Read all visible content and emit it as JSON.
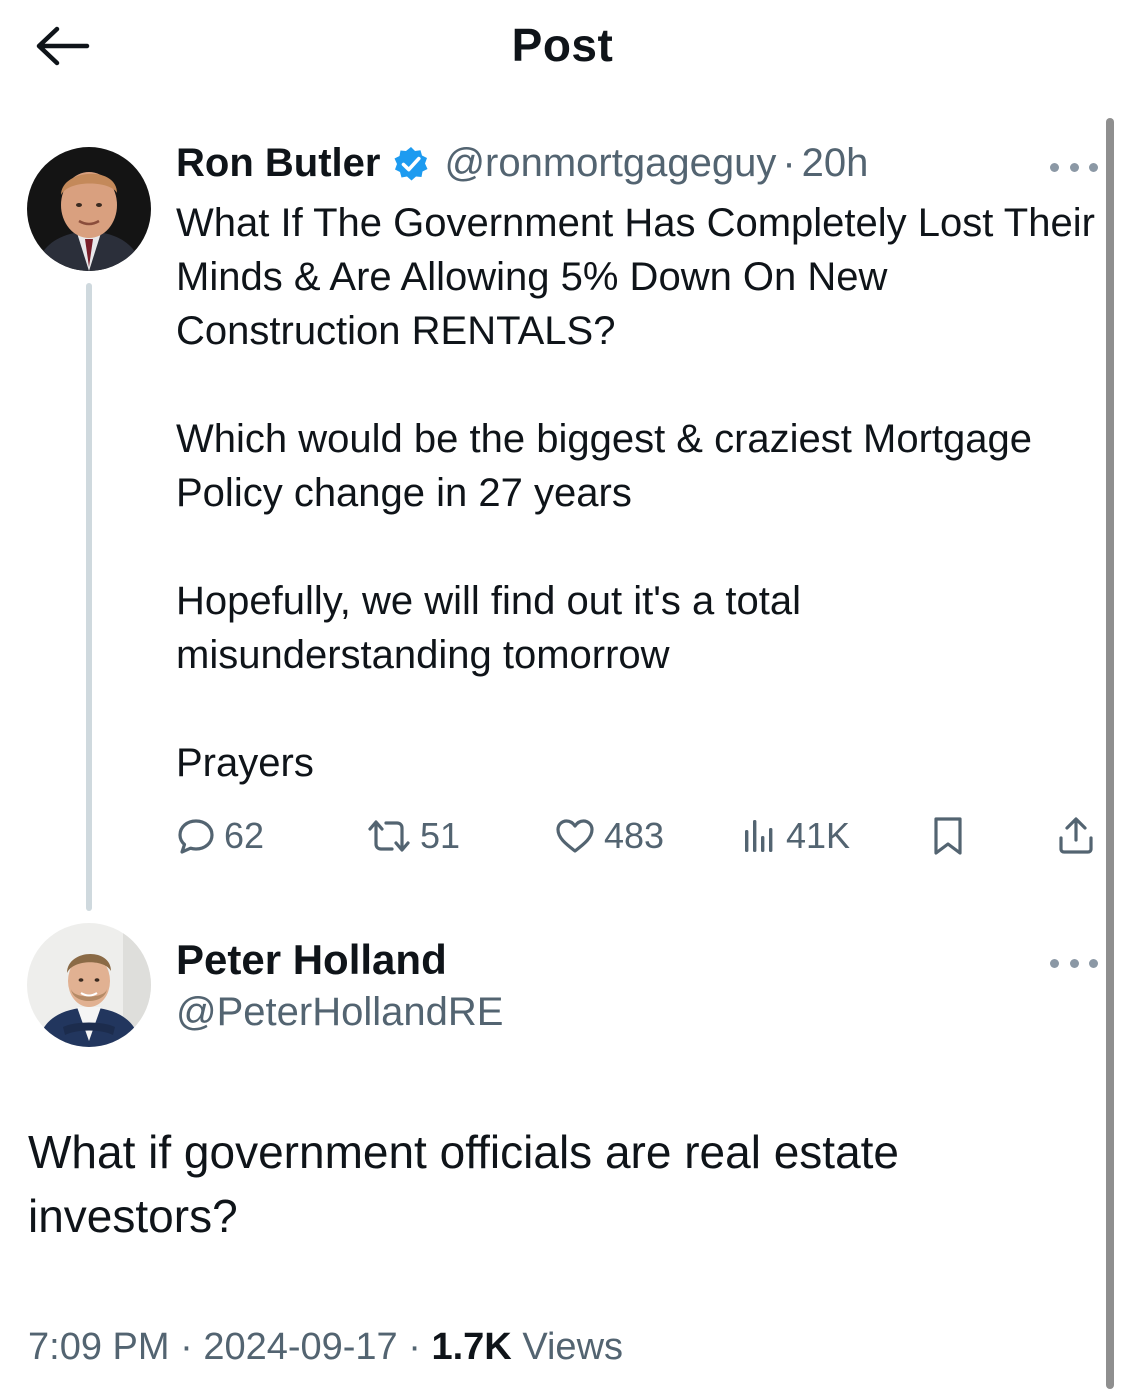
{
  "header": {
    "title": "Post",
    "back_icon": "arrow-left-icon"
  },
  "original_post": {
    "author_name": "Ron Butler",
    "verified": true,
    "handle": "@ronmortgageguy",
    "separator": "·",
    "time": "20h",
    "paragraphs": [
      "What If The Government Has Completely Lost Their Minds & Are Allowing 5% Down On New Construction RENTALS?",
      "Which would be the biggest & craziest Mortgage Policy change in 27 years",
      "Hopefully, we will find out it's a total misunderstanding tomorrow",
      "Prayers"
    ],
    "stats": {
      "replies": "62",
      "reposts": "51",
      "likes": "483",
      "views": "41K"
    },
    "colors": {
      "verified_badge": "#1d9bf0",
      "secondary_text": "#536471",
      "thread_line": "#cfd9de"
    }
  },
  "reply_post": {
    "author_name": "Peter Holland",
    "handle": "@PeterHollandRE",
    "text": "What if government officials are real estate investors?",
    "timestamp": "7:09 PM",
    "separator": "·",
    "date": "2024-09-17",
    "views_count": "1.7K",
    "views_label": "Views"
  }
}
